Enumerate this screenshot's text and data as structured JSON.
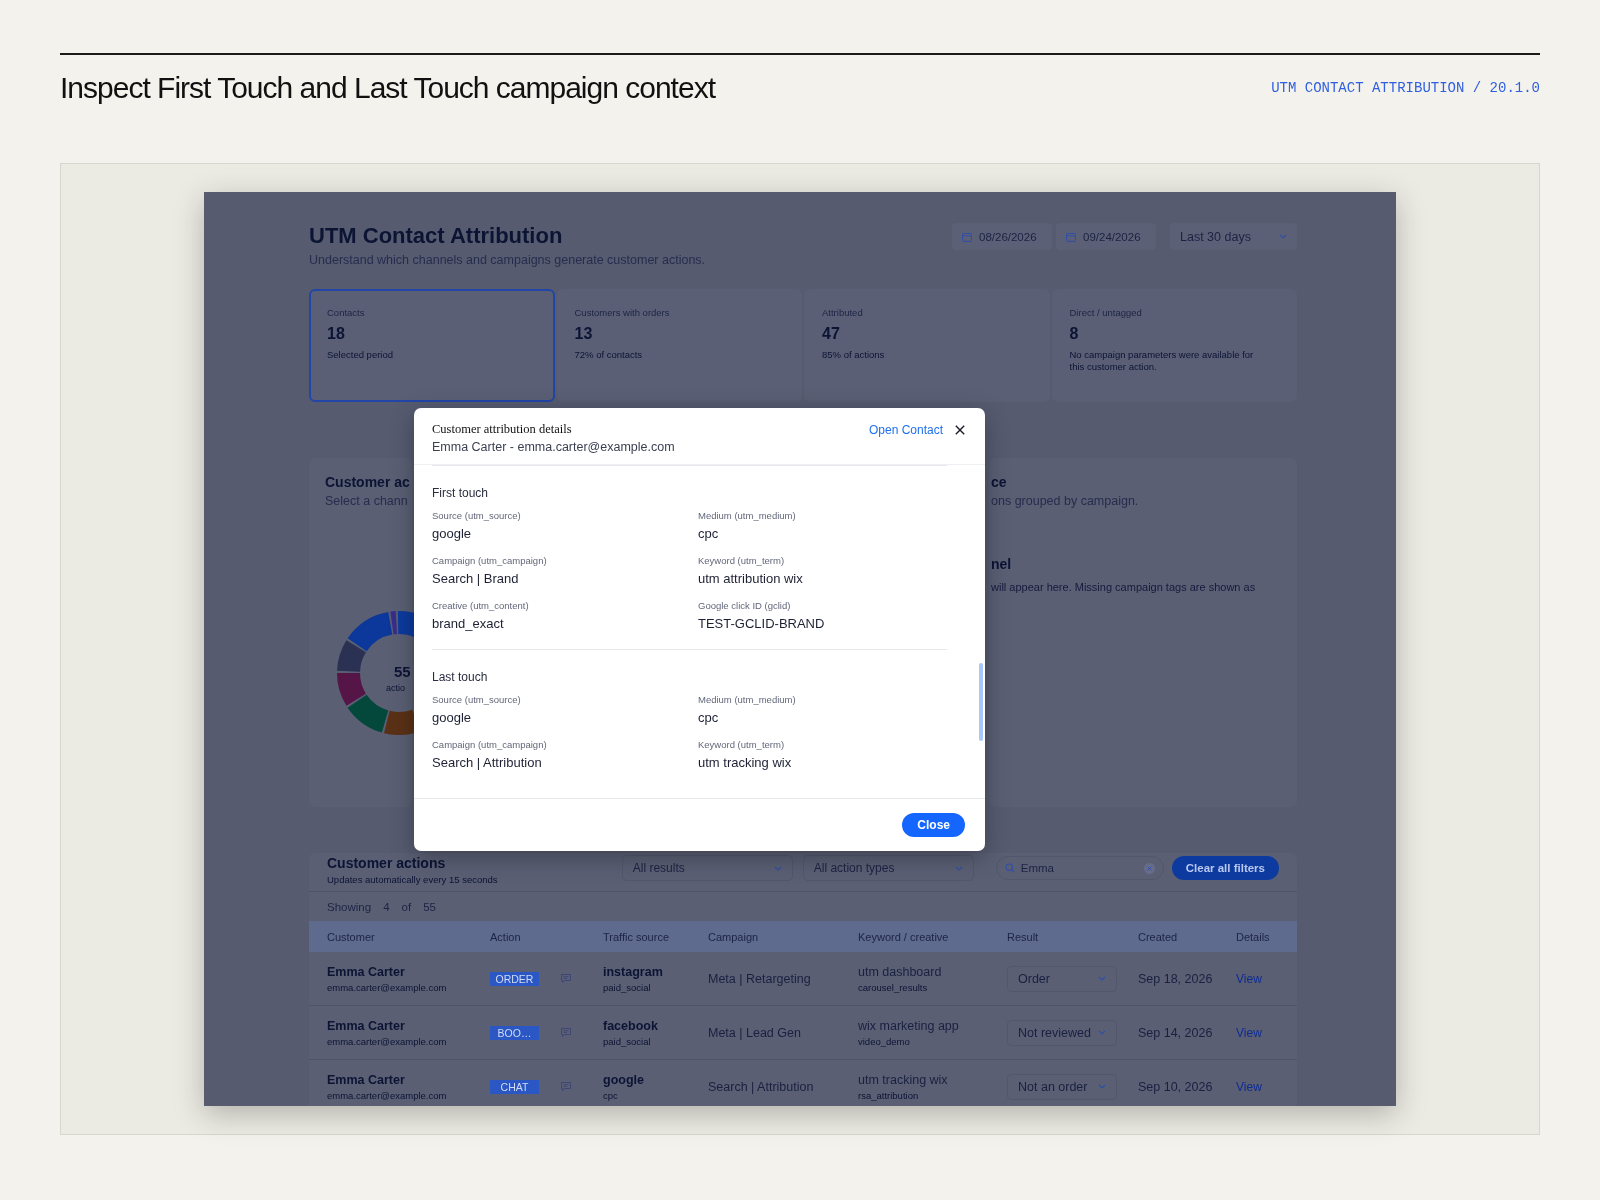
{
  "page": {
    "title": "Inspect First Touch and Last Touch campaign context",
    "version_label": "UTM CONTACT ATTRIBUTION / 20.1.0"
  },
  "dashboard": {
    "title": "UTM Contact Attribution",
    "subtitle": "Understand which channels and campaigns generate customer actions.",
    "date_from": "08/26/2026",
    "date_to": "09/24/2026",
    "range": "Last 30 days",
    "kpis": [
      {
        "label": "Contacts",
        "value": "18",
        "note": "Selected period",
        "selected": true
      },
      {
        "label": "Customers with orders",
        "value": "13",
        "note": "72% of contacts",
        "selected": false
      },
      {
        "label": "Attributed",
        "value": "47",
        "note": "85% of actions",
        "selected": false
      },
      {
        "label": "Direct / untagged",
        "value": "8",
        "note": "No campaign parameters were available for this customer action.",
        "selected": false
      }
    ],
    "actions_panel": {
      "title": "Customer ac",
      "subtitle": "Select a chann",
      "chart_total": "55",
      "chart_caption": "actio"
    },
    "source_panel": {
      "title": "ce",
      "subtitle": "ons grouped by campaign.",
      "section_title": "nel",
      "section_note": "will appear here. Missing campaign tags are shown as"
    },
    "table_panel": {
      "title": "Customer actions",
      "subtitle": "Updates automatically every 15 seconds",
      "filters": [
        "All results",
        "All action types"
      ],
      "search": {
        "value": "Emma"
      },
      "clear_button": "Clear all filters",
      "showing": {
        "label": "Showing",
        "count": "4",
        "of": "of",
        "total": "55"
      },
      "columns": [
        "Customer",
        "Action",
        "Traffic source",
        "Campaign",
        "Keyword / creative",
        "Result",
        "Created",
        "Details"
      ],
      "rows": [
        {
          "name": "Emma Carter",
          "email": "emma.carter@example.com",
          "action": "ORDER",
          "source": "instagram",
          "medium": "paid_social",
          "campaign": "Meta | Retargeting",
          "keyword": "utm dashboard",
          "creative": "carousel_results",
          "result": "Order",
          "created": "Sep 18, 2026",
          "details": "View"
        },
        {
          "name": "Emma Carter",
          "email": "emma.carter@example.com",
          "action": "BOO…",
          "source": "facebook",
          "medium": "paid_social",
          "campaign": "Meta | Lead Gen",
          "keyword": "wix marketing app",
          "creative": "video_demo",
          "result": "Not reviewed",
          "created": "Sep 14, 2026",
          "details": "View"
        },
        {
          "name": "Emma Carter",
          "email": "emma.carter@example.com",
          "action": "CHAT",
          "source": "google",
          "medium": "cpc",
          "campaign": "Search | Attribution",
          "keyword": "utm tracking wix",
          "creative": "rsa_attribution",
          "result": "Not an order",
          "created": "Sep 10, 2026",
          "details": "View"
        }
      ]
    }
  },
  "modal": {
    "title": "Customer attribution details",
    "subtitle": "Emma Carter - emma.carter@example.com",
    "link": "Open Contact",
    "sections": [
      {
        "title": "First touch",
        "fields": [
          {
            "label": "Source (utm_source)",
            "value": "google"
          },
          {
            "label": "Medium (utm_medium)",
            "value": "cpc"
          },
          {
            "label": "Campaign (utm_campaign)",
            "value": "Search | Brand"
          },
          {
            "label": "Keyword (utm_term)",
            "value": "utm attribution wix"
          },
          {
            "label": "Creative (utm_content)",
            "value": "brand_exact"
          },
          {
            "label": "Google click ID (gclid)",
            "value": "TEST-GCLID-BRAND"
          }
        ]
      },
      {
        "title": "Last touch",
        "fields": [
          {
            "label": "Source (utm_source)",
            "value": "google"
          },
          {
            "label": "Medium (utm_medium)",
            "value": "cpc"
          },
          {
            "label": "Campaign (utm_campaign)",
            "value": "Search | Attribution"
          },
          {
            "label": "Keyword (utm_term)",
            "value": "utm tracking wix"
          }
        ]
      }
    ],
    "close_button": "Close"
  }
}
